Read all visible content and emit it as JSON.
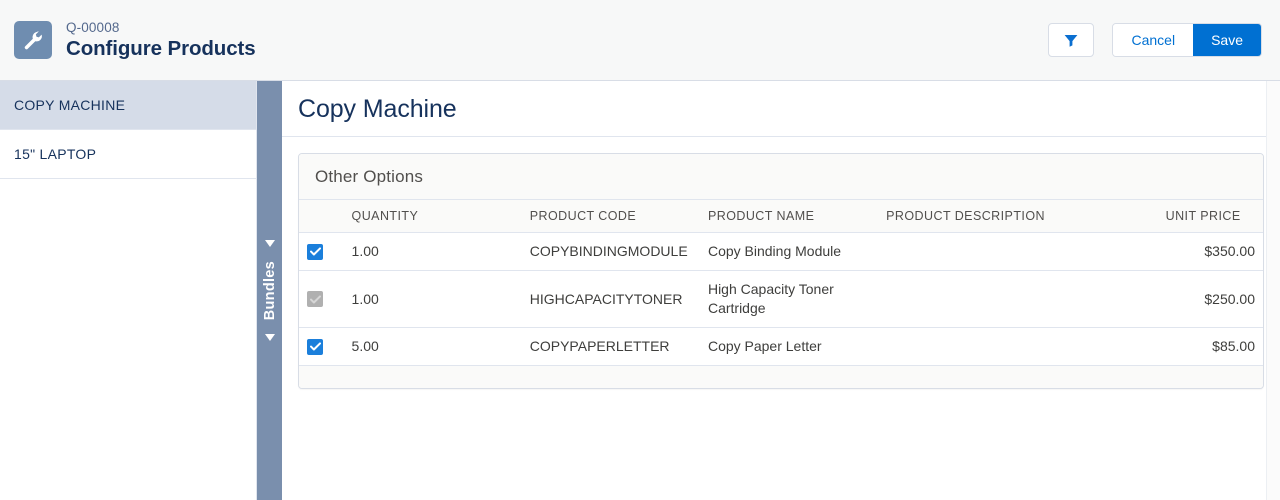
{
  "header": {
    "record_id": "Q-00008",
    "title": "Configure Products",
    "entity_icon": "wrench-icon",
    "filter_icon": "filter-funnel-icon",
    "cancel_label": "Cancel",
    "save_label": "Save",
    "accent_color": "#0070d2",
    "entity_icon_color": "#6f8db0"
  },
  "sidebar": {
    "items": [
      {
        "label": "COPY MACHINE",
        "selected": true
      },
      {
        "label": "15\" LAPTOP",
        "selected": false
      }
    ]
  },
  "bundles_tab": {
    "label": "Bundles",
    "top_icon": "triangle-up-icon",
    "bottom_icon": "triangle-down-icon",
    "color": "#7a8fad"
  },
  "main": {
    "title": "Copy Machine",
    "card": {
      "title": "Other Options",
      "columns": [
        {
          "key": "select",
          "label": ""
        },
        {
          "key": "quantity",
          "label": "QUANTITY"
        },
        {
          "key": "product_code",
          "label": "PRODUCT CODE"
        },
        {
          "key": "product_name",
          "label": "PRODUCT NAME"
        },
        {
          "key": "product_description",
          "label": "PRODUCT DESCRIPTION"
        },
        {
          "key": "unit_price",
          "label": "UNIT PRICE"
        }
      ],
      "rows": [
        {
          "selected": true,
          "disabled": false,
          "quantity": "1.00",
          "product_code": "COPYBINDINGMODULE",
          "product_name": "Copy Binding Module",
          "product_description": "",
          "unit_price": "$350.00"
        },
        {
          "selected": true,
          "disabled": true,
          "quantity": "1.00",
          "product_code": "HIGHCAPACITYTONER",
          "product_name": "High Capacity Toner Cartridge",
          "product_description": "",
          "unit_price": "$250.00"
        },
        {
          "selected": true,
          "disabled": false,
          "quantity": "5.00",
          "product_code": "COPYPAPERLETTER",
          "product_name": "Copy Paper Letter",
          "product_description": "",
          "unit_price": "$85.00"
        }
      ]
    }
  }
}
